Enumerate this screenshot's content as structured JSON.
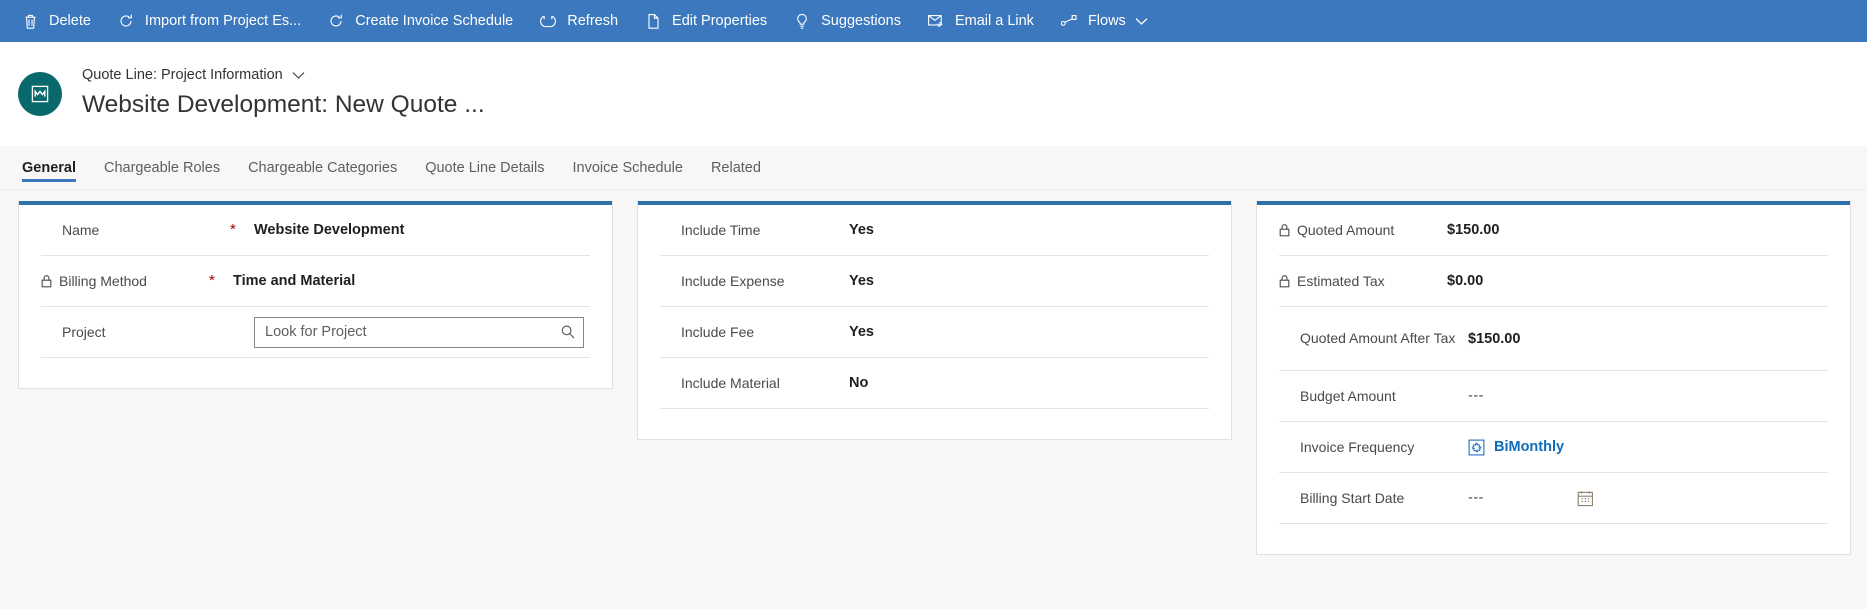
{
  "commandbar": {
    "background": "#3b78bd",
    "items": [
      {
        "label": "Delete",
        "icon": "trash-icon"
      },
      {
        "label": "Import from Project Es...",
        "icon": "refresh-import-icon"
      },
      {
        "label": "Create Invoice Schedule",
        "icon": "refresh-create-icon"
      },
      {
        "label": "Refresh",
        "icon": "refresh-icon"
      },
      {
        "label": "Edit Properties",
        "icon": "edit-properties-icon"
      },
      {
        "label": "Suggestions",
        "icon": "lightbulb-icon"
      },
      {
        "label": "Email a Link",
        "icon": "email-link-icon"
      },
      {
        "label": "Flows",
        "icon": "flows-icon",
        "chevron": true
      }
    ]
  },
  "header": {
    "entity_label": "Quote Line: Project Information",
    "record_title": "Website Development: New Quote ...",
    "avatar_color": "#09686c",
    "avatar_icon": "quote-line-entity-icon"
  },
  "tabs": [
    {
      "label": "General",
      "active": true
    },
    {
      "label": "Chargeable Roles",
      "active": false
    },
    {
      "label": "Chargeable Categories",
      "active": false
    },
    {
      "label": "Quote Line Details",
      "active": false
    },
    {
      "label": "Invoice Schedule",
      "active": false
    },
    {
      "label": "Related",
      "active": false
    }
  ],
  "accent_color": "#2f72ab",
  "columns": {
    "left": {
      "fields": [
        {
          "label": "Name",
          "locked": false,
          "required": "*",
          "type": "text",
          "value": "Website Development"
        },
        {
          "label": "Billing Method",
          "locked": true,
          "required": "*",
          "type": "text",
          "value": "Time and Material"
        },
        {
          "label": "Project",
          "locked": false,
          "required": "",
          "type": "lookup",
          "value": "",
          "placeholder": "Look for Project",
          "search_icon": "search-icon"
        }
      ]
    },
    "middle": {
      "fields": [
        {
          "label": "Include Time",
          "locked": false,
          "required": "",
          "type": "text",
          "value": "Yes"
        },
        {
          "label": "Include Expense",
          "locked": false,
          "required": "",
          "type": "text",
          "value": "Yes"
        },
        {
          "label": "Include Fee",
          "locked": false,
          "required": "",
          "type": "text",
          "value": "Yes"
        },
        {
          "label": "Include Material",
          "locked": false,
          "required": "",
          "type": "text",
          "value": "No"
        }
      ]
    },
    "right": {
      "fields": [
        {
          "label": "Quoted Amount",
          "locked": true,
          "required": "",
          "type": "text",
          "value": "$150.00"
        },
        {
          "label": "Estimated Tax",
          "locked": true,
          "required": "",
          "type": "text",
          "value": "$0.00"
        },
        {
          "label": "Quoted Amount After Tax",
          "locked": false,
          "required": "",
          "type": "text",
          "value": "$150.00"
        },
        {
          "label": "Budget Amount",
          "locked": false,
          "required": "",
          "type": "dashes",
          "value": "---"
        },
        {
          "label": "Invoice Frequency",
          "locked": false,
          "required": "",
          "type": "link",
          "value": "BiMonthly",
          "badge_icon": "invoice-frequency-entity-icon",
          "link_color": "#0f6cbd"
        },
        {
          "label": "Billing Start Date",
          "locked": false,
          "required": "",
          "type": "date",
          "value": "---",
          "calendar_icon": "calendar-icon"
        }
      ]
    }
  }
}
